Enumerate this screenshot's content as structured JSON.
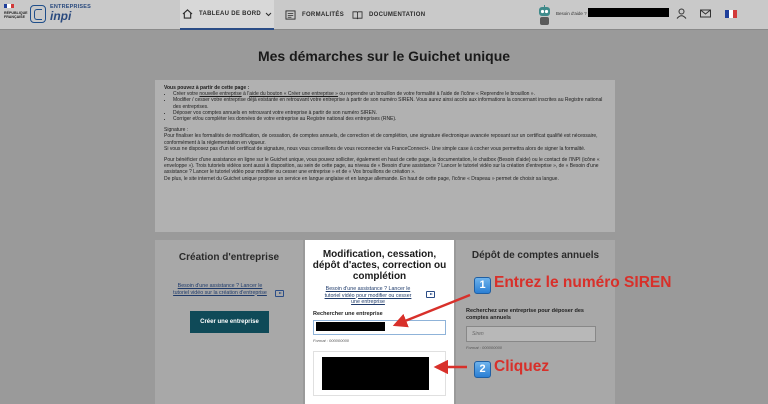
{
  "header": {
    "gov_logo_text": "RÉPUBLIQUE FRANÇAISE",
    "brand_top": "ENTREPRISES",
    "brand_main": "inpi",
    "nav": [
      {
        "label": "TABLEAU DE BORD",
        "icon": "home-icon",
        "active": true,
        "has_dropdown": true
      },
      {
        "label": "FORMALITÉS",
        "icon": "list-icon",
        "active": false
      },
      {
        "label": "DOCUMENTATION",
        "icon": "book-icon",
        "active": false
      }
    ],
    "help_label": "Besoin d'aide ?",
    "icons": [
      "user-icon",
      "mail-icon",
      "fr-flag-icon"
    ],
    "colors": {
      "header_bg": "#c9c9c9",
      "brand": "#2a4a7e",
      "primary_button": "#0f4a58",
      "annotation": "#d8302a"
    }
  },
  "page": {
    "title": "Mes démarches sur le Guichet unique"
  },
  "info": {
    "intro": "Vous pouvez à partir de cette page :",
    "bullets": [
      [
        "Créer votre ",
        "nouvelle entreprise",
        " à l'",
        "aide du bouton « Créer une entreprise »",
        " ou reprendre un brouillon de votre formalité à l'aide de l'icône « Reprendre le brouillon »."
      ],
      "Modifier / cesser votre entreprise déjà existante en retrouvant votre entreprise à partir de son numéro SIREN. Vous aurez ainsi accès aux informations la concernant inscrites au Registre national des entreprises.",
      "Déposer vos comptes annuels en retrouvant votre entreprise à partir de son numéro SIREN.",
      "Corriger et/ou compléter les données de votre entreprise au Registre national des entreprises (RNE)."
    ],
    "signature_title": "Signature :",
    "signature_p1": "Pour finaliser les formalités de modification, de cessation, de comptes annuels, de correction et de complétion, une signature électronique avancée reposant sur un certificat qualifié est nécessaire, conformément à la réglementation en vigueur.",
    "signature_p2": "Si vous ne disposez pas d'un tel certificat de signature, nous vous conseillons de vous reconnecter via FranceConnect+. Une simple case à cocher vous permettra alors de signer la formalité.",
    "assist_p": "Pour bénéficier d'une assistance en ligne sur le Guichet unique, vous pouvez solliciter, également en haut de cette page, la documentation, le chatbox (Besoin d'aide) ou le contact de l'INPI (icône « enveloppe »). Trois tutoriels vidéos sont aussi à disposition, au sein de cette page, au niveau de « Besoin d'une assistance ? Lancer le tutoriel vidéo sur la création d'entreprise », de « Besoin d'une assistance ? Lancer le tutoriel vidéo pour modifier ou cesser une entreprise » et de « Vos brouillons de création ».",
    "lang_p": "De plus, le site internet du Guichet unique propose un service en langue anglaise et en langue allemande. En haut de cette page, l'icône « Drapeau » permet de choisir sa langue."
  },
  "cards": {
    "creation": {
      "title": "Création d'entreprise",
      "assist_link": "Besoin d'une assistance ? Lancer le tutoriel vidéo sur la création d'entreprise",
      "button": "Créer une entreprise"
    },
    "modification": {
      "title": "Modification, cessation, dépôt d'actes, correction ou complétion",
      "assist_link": "Besoin d'une assistance ? Lancer le tutoriel vidéo pour modifier ou cesser une entreprise",
      "search_label": "Rechercher une entreprise",
      "search_hint": "Format : 000000000"
    },
    "comptes": {
      "title": "Dépôt de comptes annuels",
      "search_label": "Recherchez une entreprise pour déposer des comptes annuels",
      "placeholder": "Siren",
      "search_hint": "Format : 000000000"
    }
  },
  "annotations": [
    {
      "number": "1",
      "text": "Entrez le numéro SIREN"
    },
    {
      "number": "2",
      "text": "Cliquez"
    }
  ]
}
